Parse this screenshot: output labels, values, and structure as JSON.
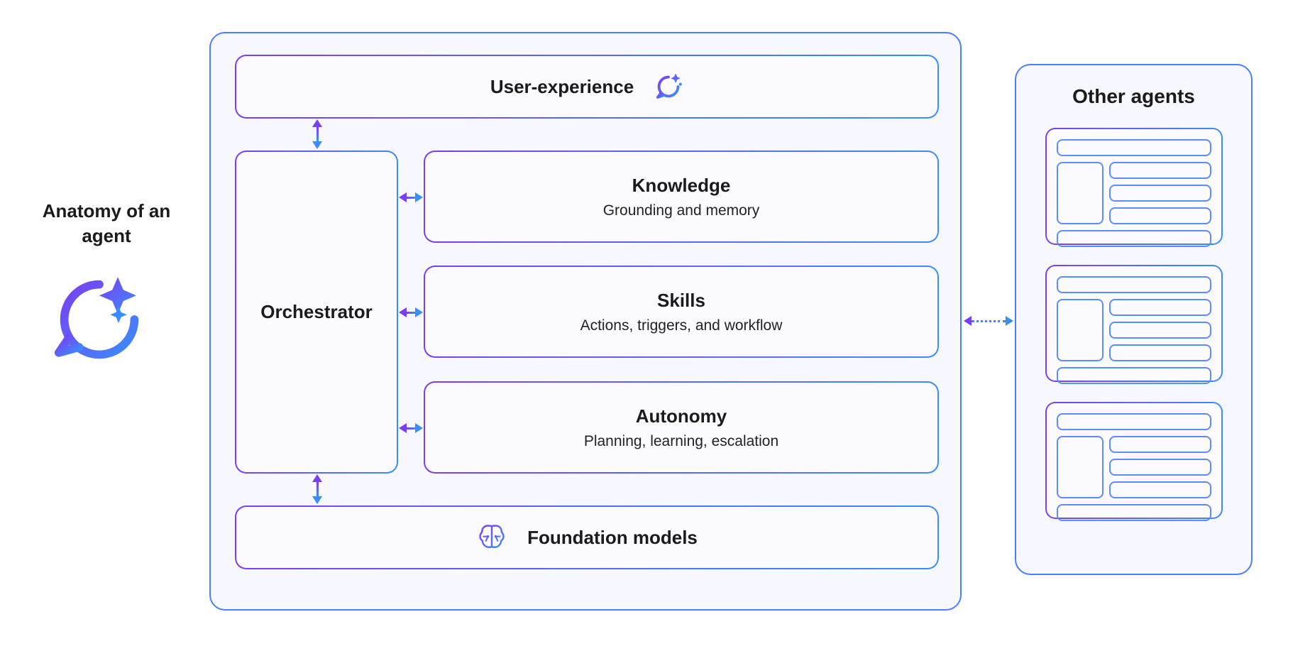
{
  "left_label": "Anatomy of an agent",
  "main": {
    "ux": {
      "title": "User-experience"
    },
    "orchestrator": {
      "title": "Orchestrator"
    },
    "knowledge": {
      "title": "Knowledge",
      "subtitle": "Grounding and memory"
    },
    "skills": {
      "title": "Skills",
      "subtitle": "Actions, triggers, and workflow"
    },
    "autonomy": {
      "title": "Autonomy",
      "subtitle": "Planning, learning, escalation"
    },
    "foundation": {
      "title": "Foundation models"
    }
  },
  "right": {
    "title": "Other agents",
    "agent_count": 3
  },
  "colors": {
    "gradient_start": "#7a3ff2",
    "gradient_end": "#3a8dff",
    "panel_border": "#4a7dff",
    "panel_bg": "#f7f8ff",
    "box_bg": "#fbfbff"
  }
}
